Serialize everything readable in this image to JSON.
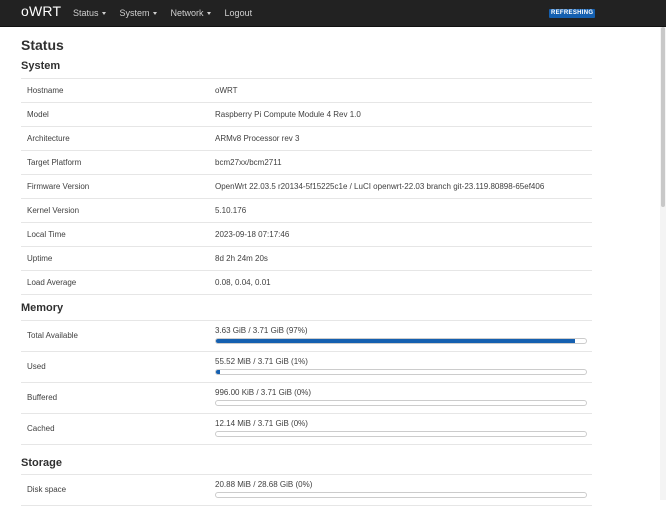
{
  "navbar": {
    "brand": "oWRT",
    "menu": [
      {
        "label": "Status",
        "dropdown": true
      },
      {
        "label": "System",
        "dropdown": true
      },
      {
        "label": "Network",
        "dropdown": true
      },
      {
        "label": "Logout",
        "dropdown": false
      }
    ],
    "badge": "REFRESHING",
    "badge_color": "#1560b0",
    "background": "#222222"
  },
  "page": {
    "title": "Status"
  },
  "system": {
    "title": "System",
    "rows": [
      {
        "label": "Hostname",
        "value": "oWRT"
      },
      {
        "label": "Model",
        "value": "Raspberry Pi Compute Module 4 Rev 1.0"
      },
      {
        "label": "Architecture",
        "value": "ARMv8 Processor rev 3"
      },
      {
        "label": "Target Platform",
        "value": "bcm27xx/bcm2711"
      },
      {
        "label": "Firmware Version",
        "value": "OpenWrt 22.03.5 r20134-5f15225c1e / LuCI openwrt-22.03 branch git-23.119.80898-65ef406"
      },
      {
        "label": "Kernel Version",
        "value": "5.10.176"
      },
      {
        "label": "Local Time",
        "value": "2023-09-18 07:17:46"
      },
      {
        "label": "Uptime",
        "value": "8d 2h 24m 20s"
      },
      {
        "label": "Load Average",
        "value": "0.08, 0.04, 0.01"
      }
    ]
  },
  "memory": {
    "title": "Memory",
    "rows": [
      {
        "label": "Total Available",
        "value": "3.63 GiB / 3.71 GiB (97%)",
        "percent": 97
      },
      {
        "label": "Used",
        "value": "55.52 MiB / 3.71 GiB (1%)",
        "percent": 1
      },
      {
        "label": "Buffered",
        "value": "996.00 KiB / 3.71 GiB (0%)",
        "percent": 0
      },
      {
        "label": "Cached",
        "value": "12.14 MiB / 3.71 GiB (0%)",
        "percent": 0
      }
    ]
  },
  "storage": {
    "title": "Storage",
    "rows": [
      {
        "label": "Disk space",
        "value": "20.88 MiB / 28.68 GiB (0%)",
        "percent": 0
      }
    ]
  }
}
